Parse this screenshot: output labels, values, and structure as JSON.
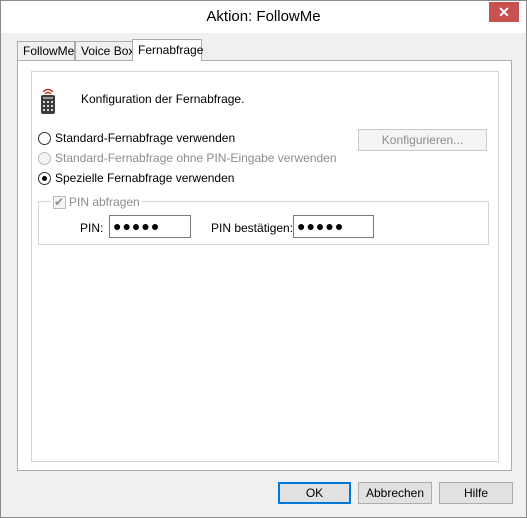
{
  "window": {
    "title": "Aktion: FollowMe",
    "close_glyph": "✕"
  },
  "tabs": [
    {
      "label": "FollowMe"
    },
    {
      "label": "Voice Box"
    },
    {
      "label": "Fernabfrage"
    }
  ],
  "intro": {
    "icon": "remote-control-icon",
    "text": "Konfiguration der Fernabfrage."
  },
  "options": [
    {
      "label": "Standard-Fernabfrage verwenden",
      "selected": false,
      "enabled": true
    },
    {
      "label": "Standard-Fernabfrage ohne PIN-Eingabe verwenden",
      "selected": false,
      "enabled": false
    },
    {
      "label": "Spezielle Fernabfrage verwenden",
      "selected": true,
      "enabled": true
    }
  ],
  "configure_button": {
    "label": "Konfigurieren...",
    "enabled": false
  },
  "pin_group": {
    "checkbox_label": "PIN abfragen",
    "checked": true,
    "enabled": false,
    "pin_label": "PIN:",
    "pin_value": "●●●●●",
    "confirm_label": "PIN bestätigen:",
    "confirm_value": "●●●●●"
  },
  "footer": {
    "ok": "OK",
    "cancel": "Abbrechen",
    "help": "Hilfe"
  },
  "colors": {
    "close_button": "#c75050",
    "default_button_border": "#0078d7",
    "disabled_text": "#8d8d8d"
  }
}
